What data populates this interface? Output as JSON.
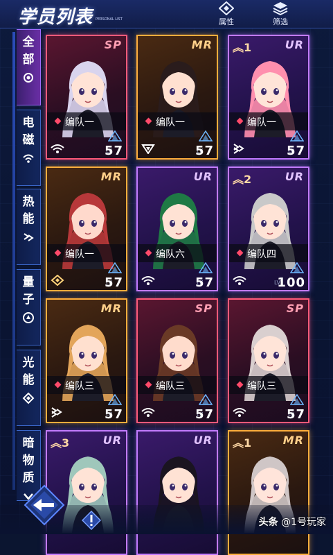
{
  "header": {
    "title": "学员列表",
    "subtitle": "PERSONAL LIST",
    "attr_label": "属性",
    "filter_label": "筛选"
  },
  "sidebar": {
    "items": [
      {
        "label": "全部",
        "icon": "all-icon",
        "active": true
      },
      {
        "label": "电磁",
        "icon": "wifi-icon",
        "active": false
      },
      {
        "label": "热能",
        "icon": "heat-icon",
        "active": false
      },
      {
        "label": "量子",
        "icon": "quantum-icon",
        "active": false
      },
      {
        "label": "光能",
        "icon": "light-icon",
        "active": false
      },
      {
        "label": "暗物质",
        "icon": "dark-matter-icon",
        "active": false
      }
    ]
  },
  "cards": [
    {
      "rarity": "SP",
      "star": "",
      "team": "编队一",
      "level": "57",
      "element": "wifi-icon",
      "hair": "#d9d4ee",
      "skin": "#ffe3d6"
    },
    {
      "rarity": "MR",
      "star": "",
      "team": "编队一",
      "level": "57",
      "element": "triangle-icon",
      "hair": "#2a1c1c",
      "skin": "#ffe0d0"
    },
    {
      "rarity": "UR",
      "star": "1",
      "team": "编队一",
      "level": "57",
      "element": "heat-icon",
      "hair": "#ff8fae",
      "skin": "#ffe4d8"
    },
    {
      "rarity": "MR",
      "star": "",
      "team": "编队一",
      "level": "57",
      "element": "diamond-icon",
      "hair": "#b8383a",
      "skin": "#ffd9cc"
    },
    {
      "rarity": "UR",
      "star": "",
      "team": "编队六",
      "level": "57",
      "element": "wifi-icon",
      "hair": "#1f7a45",
      "skin": "#ffe2d4"
    },
    {
      "rarity": "UR",
      "star": "2",
      "team": "编队四",
      "level": "100",
      "element": "wifi-icon",
      "hair": "#c9c9c9",
      "skin": "#ffe3d6"
    },
    {
      "rarity": "MR",
      "star": "",
      "team": "编队三",
      "level": "57",
      "element": "heat-icon",
      "hair": "#e3a55a",
      "skin": "#ffe0cf"
    },
    {
      "rarity": "SP",
      "star": "",
      "team": "编队三",
      "level": "57",
      "element": "wifi-icon",
      "hair": "#6a3a26",
      "skin": "#ffdccc"
    },
    {
      "rarity": "SP",
      "star": "",
      "team": "编队三",
      "level": "57",
      "element": "wifi-icon",
      "hair": "#d9cfcf",
      "skin": "#ffe4d8"
    },
    {
      "rarity": "UR",
      "star": "3",
      "team": "",
      "level": "",
      "element": "",
      "hair": "#9fc7bb",
      "skin": "#ffe3d6"
    },
    {
      "rarity": "UR",
      "star": "",
      "team": "",
      "level": "",
      "element": "",
      "hair": "#1a1420",
      "skin": "#ffe2d4"
    },
    {
      "rarity": "MR",
      "star": "1",
      "team": "",
      "level": "",
      "element": "",
      "hair": "#cfc6c6",
      "skin": "#ffe4da"
    }
  ],
  "lv_label": "LV",
  "watermark": {
    "brand": "头条",
    "account": "@1号玩家"
  }
}
